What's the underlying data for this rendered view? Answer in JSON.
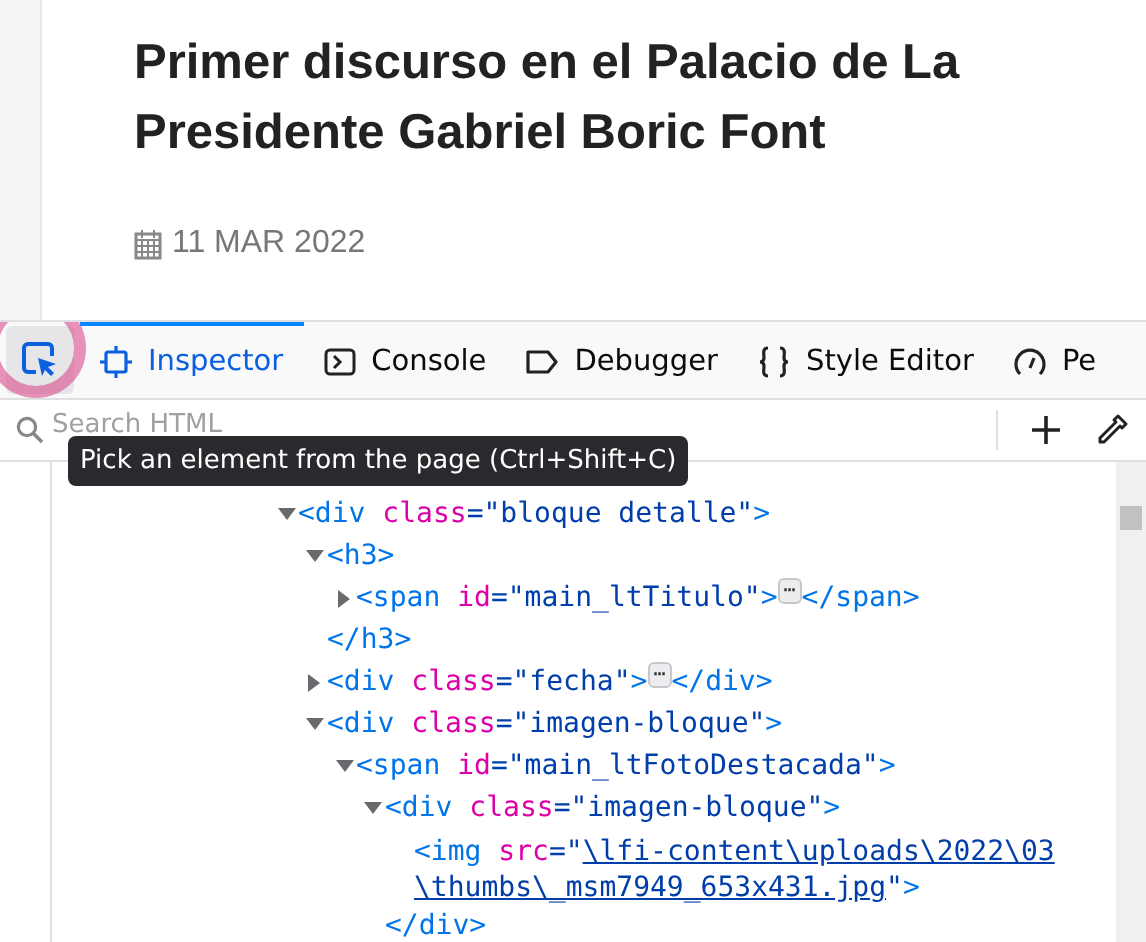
{
  "article": {
    "title_lines": [
      "Primer discurso en el Palacio de La",
      "Presidente Gabriel Boric Font"
    ],
    "date": "11 MAR 2022"
  },
  "toolbar": {
    "tabs": [
      {
        "label": "Inspector",
        "selected": true
      },
      {
        "label": "Console",
        "selected": false
      },
      {
        "label": "Debugger",
        "selected": false
      },
      {
        "label": "Style Editor",
        "selected": false
      },
      {
        "label": "Pe",
        "selected": false
      }
    ]
  },
  "search": {
    "placeholder": "Search HTML"
  },
  "tooltip": "Pick an element from the page (Ctrl+Shift+C)",
  "tree": [
    {
      "tokens": [
        {
          "kind": "tag",
          "s": "<div"
        },
        {
          "kind": "attr",
          "s": "class"
        },
        {
          "kind": "val",
          "s": "=\"bloque detalle\""
        },
        {
          "kind": "tag",
          "s": ">"
        }
      ],
      "expanded": true,
      "children": [
        {
          "tokens": [
            {
              "kind": "tag",
              "s": "<h3>"
            }
          ],
          "expanded": true,
          "close": "</h3>",
          "children": [
            {
              "tokens": [
                {
                  "kind": "tag",
                  "s": "<span"
                },
                {
                  "kind": "attr",
                  "s": "id"
                },
                {
                  "kind": "val",
                  "s": "=\"main_ltTitulo\""
                },
                {
                  "kind": "tag",
                  "s": ">"
                }
              ],
              "expanded": false,
              "badge": "⋯",
              "close": "</span>"
            }
          ]
        },
        {
          "tokens": [
            {
              "kind": "tag",
              "s": "<div"
            },
            {
              "kind": "attr",
              "s": "class"
            },
            {
              "kind": "val",
              "s": "=\"fecha\""
            },
            {
              "kind": "tag",
              "s": ">"
            }
          ],
          "expanded": false,
          "badge": "⋯",
          "close": "</div>"
        },
        {
          "tokens": [
            {
              "kind": "tag",
              "s": "<div"
            },
            {
              "kind": "attr",
              "s": "class"
            },
            {
              "kind": "val",
              "s": "=\"imagen-bloque\""
            },
            {
              "kind": "tag",
              "s": ">"
            }
          ],
          "expanded": true,
          "children": [
            {
              "tokens": [
                {
                  "kind": "tag",
                  "s": "<span"
                },
                {
                  "kind": "attr",
                  "s": "id"
                },
                {
                  "kind": "val",
                  "s": "=\"main_ltFotoDestacada\""
                },
                {
                  "kind": "tag",
                  "s": ">"
                }
              ],
              "expanded": true,
              "children": [
                {
                  "tokens": [
                    {
                      "kind": "tag",
                      "s": "<div"
                    },
                    {
                      "kind": "attr",
                      "s": "class"
                    },
                    {
                      "kind": "val",
                      "s": "=\"imagen-bloque\""
                    },
                    {
                      "kind": "tag",
                      "s": ">"
                    }
                  ],
                  "expanded": true,
                  "close": "</div>",
                  "children": [
                    {
                      "tokens": [
                        {
                          "kind": "tag",
                          "s": "<img"
                        },
                        {
                          "kind": "attr",
                          "s": "src"
                        },
                        {
                          "kind": "val",
                          "s": "=\""
                        },
                        {
                          "kind": "link",
                          "s": "\\lfi-content\\uploads\\2022\\03\\thumbs\\_msm7949_653x431.jpg"
                        },
                        {
                          "kind": "val",
                          "s": "\""
                        },
                        {
                          "kind": "tag",
                          "s": ">"
                        }
                      ]
                    }
                  ]
                }
              ]
            }
          ]
        }
      ]
    }
  ]
}
